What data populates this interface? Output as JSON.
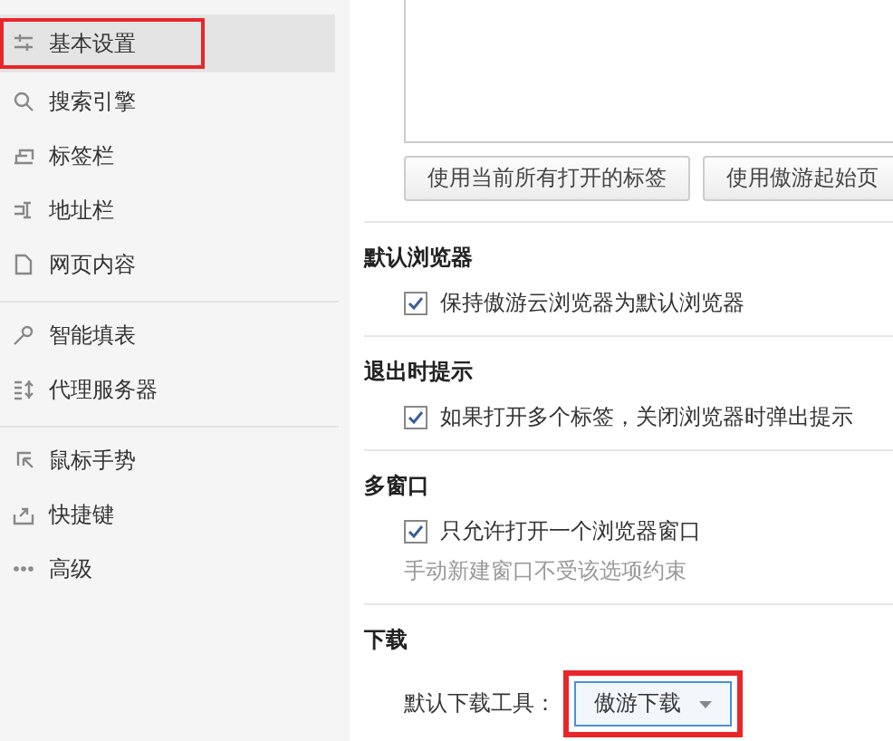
{
  "sidebar": {
    "groups": [
      {
        "items": [
          {
            "label": "基本设置",
            "kind": "sliders",
            "selected": true,
            "highlighted": true
          },
          {
            "label": "搜索引擎",
            "kind": "search",
            "selected": false,
            "highlighted": false
          },
          {
            "label": "标签栏",
            "kind": "tabs",
            "selected": false,
            "highlighted": false
          },
          {
            "label": "地址栏",
            "kind": "address",
            "selected": false,
            "highlighted": false
          },
          {
            "label": "网页内容",
            "kind": "page",
            "selected": false,
            "highlighted": false
          }
        ]
      },
      {
        "items": [
          {
            "label": "智能填表",
            "kind": "key",
            "selected": false,
            "highlighted": false
          },
          {
            "label": "代理服务器",
            "kind": "proxy",
            "selected": false,
            "highlighted": false
          }
        ]
      },
      {
        "items": [
          {
            "label": "鼠标手势",
            "kind": "cursor",
            "selected": false,
            "highlighted": false
          },
          {
            "label": "快捷键",
            "kind": "shortcut",
            "selected": false,
            "highlighted": false
          },
          {
            "label": "高级",
            "kind": "more",
            "selected": false,
            "highlighted": false
          }
        ]
      }
    ]
  },
  "startup": {
    "buttons": [
      "使用当前所有打开的标签",
      "使用傲游起始页"
    ]
  },
  "sections": [
    {
      "title": "默认浏览器",
      "options": [
        {
          "label": "保持傲游云浏览器为默认浏览器",
          "checked": true
        }
      ]
    },
    {
      "title": "退出时提示",
      "options": [
        {
          "label": "如果打开多个标签，关闭浏览器时弹出提示",
          "checked": true
        }
      ]
    },
    {
      "title": "多窗口",
      "options": [
        {
          "label": "只允许打开一个浏览器窗口",
          "checked": true
        }
      ],
      "hint": "手动新建窗口不受该选项约束"
    },
    {
      "title": "下载",
      "dropdown": {
        "label": "默认下载工具：",
        "value": "傲游下载",
        "highlighted": true
      }
    }
  ]
}
